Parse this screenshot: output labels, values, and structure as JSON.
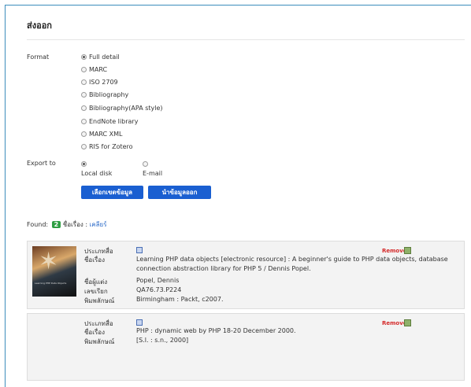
{
  "title": "ส่งออก",
  "format": {
    "label": "Format",
    "options": [
      "Full detail",
      "MARC",
      "ISO 2709",
      "Bibliography",
      "Bibliography(APA style)",
      "EndNote library",
      "MARC XML",
      "RIS for Zotero"
    ],
    "selected": "Full detail"
  },
  "export_to": {
    "label": "Export to",
    "options": [
      "Local disk",
      "E-mail"
    ],
    "selected": "Local disk"
  },
  "buttons": {
    "select": "เลือกเขตข้อมูล",
    "export": "นำข้อมูลออก"
  },
  "found": {
    "prefix": "Found:",
    "count": "2",
    "unit": "ชื่อเรื่อง :",
    "clear": "เคลียร์"
  },
  "records": [
    {
      "fields": [
        {
          "label": "ประเภทสื่อ",
          "value": ""
        },
        {
          "label": "ชื่อเรื่อง",
          "value": "Learning PHP data objects [electronic resource] : A beginner's guide to PHP data objects, database connection abstraction library for PHP 5 / Dennis Popel."
        },
        {
          "label": "ชื่อผู้แต่ง",
          "value": "Popel, Dennis"
        },
        {
          "label": "เลขเรียก",
          "value": "QA76.73.P224"
        },
        {
          "label": "พิมพลักษณ์",
          "value": "Birmingham : Packt, c2007."
        }
      ],
      "cover_caption": "Learning PHP Data Objects",
      "remove": "Remove"
    },
    {
      "fields": [
        {
          "label": "ประเภทสื่อ",
          "value": ""
        },
        {
          "label": "ชื่อเรื่อง",
          "value": "PHP : dynamic web by PHP 18-20 December 2000."
        },
        {
          "label": "พิมพลักษณ์",
          "value": "[S.l. : s.n., 2000]"
        }
      ],
      "remove": "Remove"
    }
  ]
}
